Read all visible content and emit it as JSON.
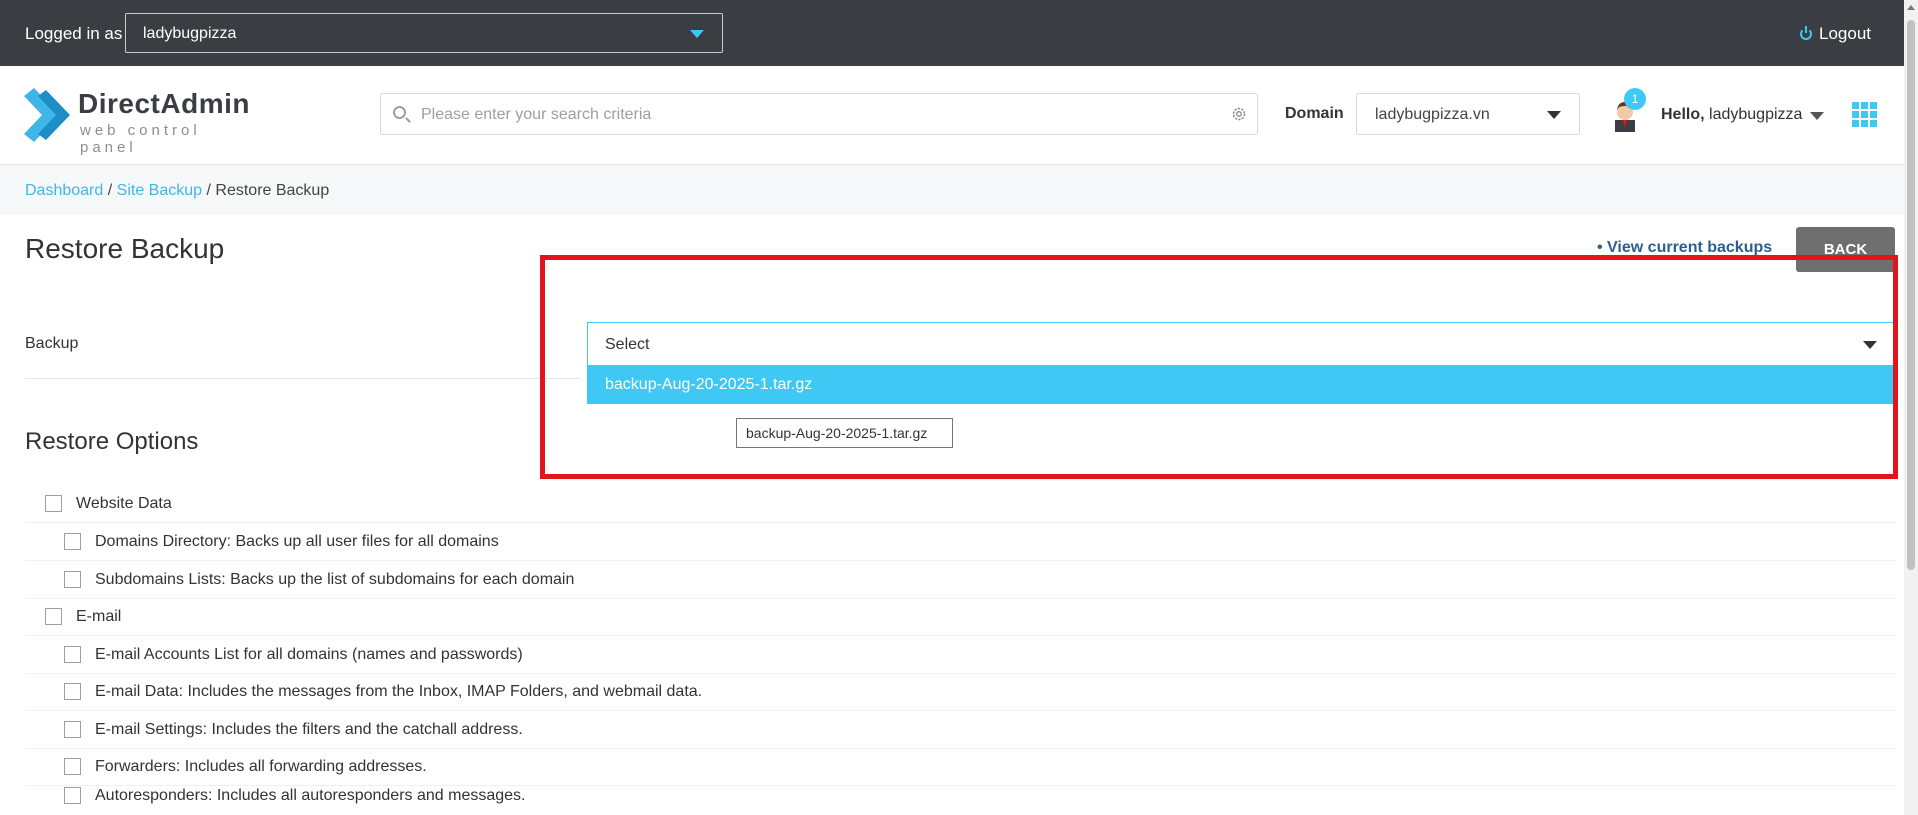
{
  "topbar": {
    "logged_label": "Logged in as",
    "user": "ladybugpizza",
    "logout": "Logout"
  },
  "header": {
    "brand": "DirectAdmin",
    "tagline": "web control panel",
    "search_placeholder": "Please enter your search criteria",
    "domain_label": "Domain",
    "domain_value": "ladybugpizza.vn",
    "notification_count": "1",
    "hello_label": "Hello,",
    "hello_user": "ladybugpizza"
  },
  "breadcrumb": {
    "items": [
      "Dashboard",
      "Site Backup",
      "Restore Backup"
    ],
    "sep": "/"
  },
  "page": {
    "title": "Restore Backup",
    "view_current": "• View current backups",
    "back": "BACK",
    "backup_label": "Backup",
    "backup_select_value": "Select",
    "dropdown_option": "backup-Aug-20-2025-1.tar.gz",
    "tooltip": "backup-Aug-20-2025-1.tar.gz",
    "restore_options_title": "Restore Options"
  },
  "options": [
    {
      "label": "Website Data",
      "indent": false
    },
    {
      "label": "Domains Directory: Backs up all user files for all domains",
      "indent": true
    },
    {
      "label": "Subdomains Lists: Backs up the list of subdomains for each domain",
      "indent": true
    },
    {
      "label": "E-mail",
      "indent": false
    },
    {
      "label": "E-mail Accounts List for all domains (names and passwords)",
      "indent": true
    },
    {
      "label": "E-mail Data: Includes the messages from the Inbox, IMAP Folders, and webmail data.",
      "indent": true
    },
    {
      "label": "E-mail Settings: Includes the filters and the catchall address.",
      "indent": true
    },
    {
      "label": "Forwarders: Includes all forwarding addresses.",
      "indent": true
    },
    {
      "label": "Autoresponders: Includes all autoresponders and messages.",
      "indent": true
    }
  ],
  "colors": {
    "accent": "#3fc8f4",
    "topbar": "#3a3d42",
    "highlight": "#e3141b"
  }
}
